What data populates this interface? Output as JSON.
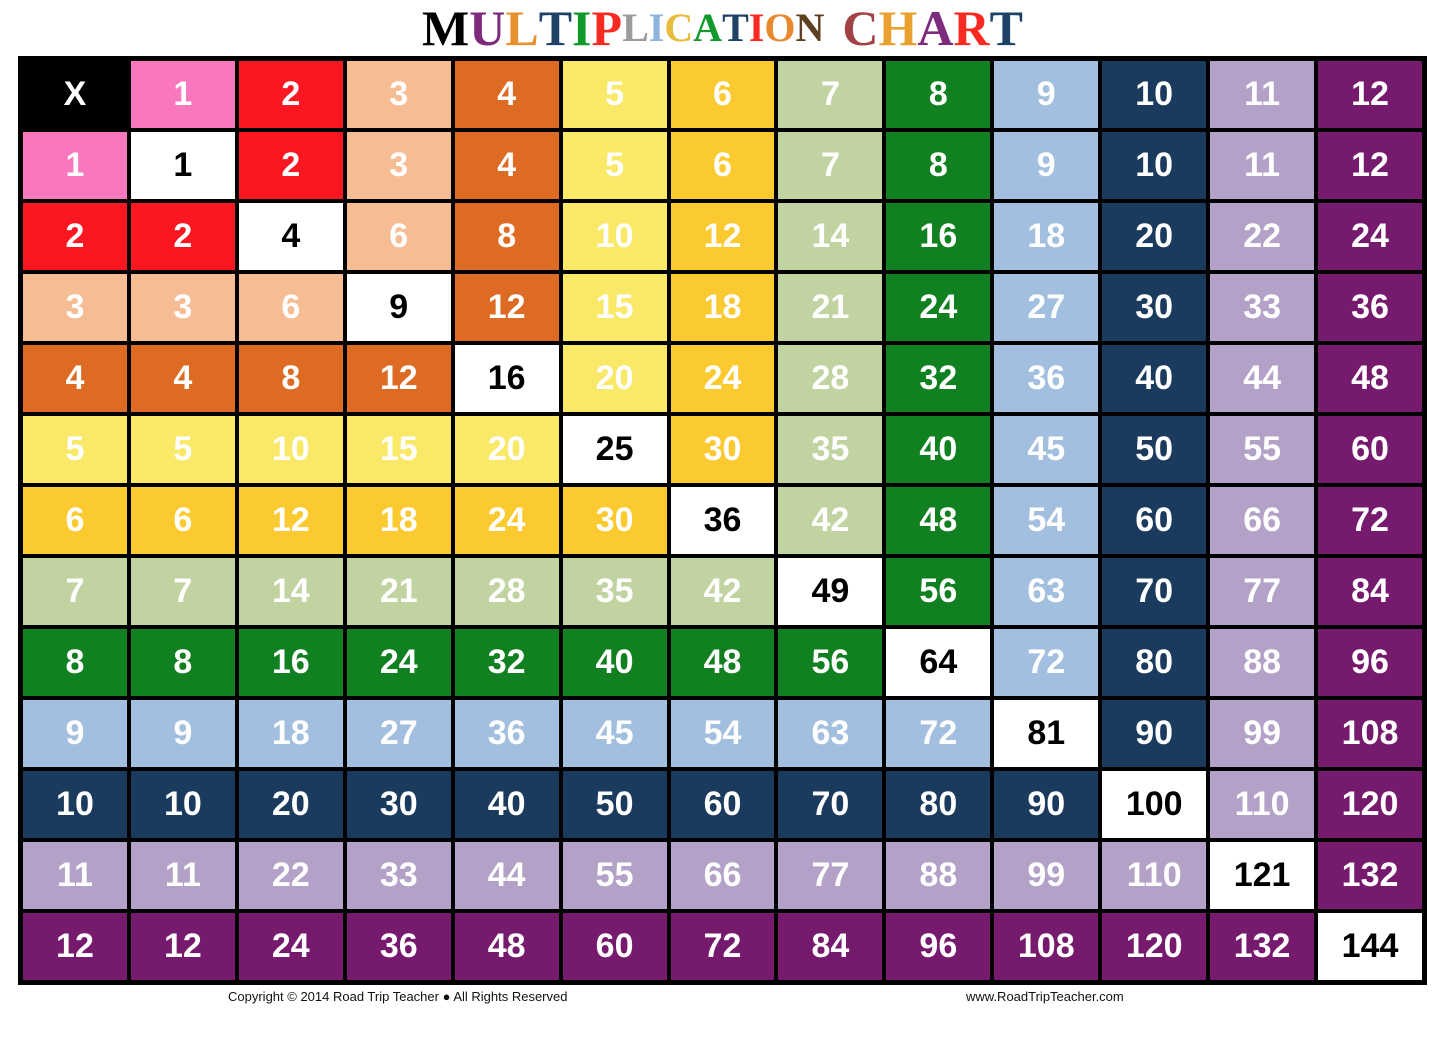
{
  "title": {
    "text": "MULTIPLICATION CHART",
    "letters": [
      {
        "ch": "M",
        "color": "#000000",
        "cap": true
      },
      {
        "ch": "U",
        "color": "#7d2b7d",
        "cap": true
      },
      {
        "ch": "L",
        "color": "#e8922f",
        "cap": true
      },
      {
        "ch": "T",
        "color": "#1d4266",
        "cap": true
      },
      {
        "ch": "I",
        "color": "#0f9a2b",
        "cap": true
      },
      {
        "ch": "P",
        "color": "#f92a22",
        "cap": true
      },
      {
        "ch": "L",
        "color": "#9b9b9b",
        "cap": false
      },
      {
        "ch": "I",
        "color": "#8cb4de",
        "cap": false
      },
      {
        "ch": "C",
        "color": "#e8bb3c",
        "cap": false
      },
      {
        "ch": "A",
        "color": "#0f9a2b",
        "cap": false
      },
      {
        "ch": "T",
        "color": "#1d4266",
        "cap": false
      },
      {
        "ch": "I",
        "color": "#f92a22",
        "cap": false
      },
      {
        "ch": "O",
        "color": "#e8892f",
        "cap": false
      },
      {
        "ch": "N",
        "color": "#5e4020",
        "cap": false
      },
      {
        "ch": " ",
        "color": "#000000",
        "cap": false
      },
      {
        "ch": "C",
        "color": "#a34244",
        "cap": true
      },
      {
        "ch": "H",
        "color": "#e8a02f",
        "cap": true
      },
      {
        "ch": "A",
        "color": "#7d2b7d",
        "cap": true
      },
      {
        "ch": "R",
        "color": "#f92a22",
        "cap": true
      },
      {
        "ch": "T",
        "color": "#1d4266",
        "cap": true
      }
    ]
  },
  "table": {
    "corner_label": "X",
    "headers": [
      "1",
      "2",
      "3",
      "4",
      "5",
      "6",
      "7",
      "8",
      "9",
      "10",
      "11",
      "12"
    ],
    "row_headers": [
      "1",
      "2",
      "3",
      "4",
      "5",
      "6",
      "7",
      "8",
      "9",
      "10",
      "11",
      "12"
    ],
    "colors": [
      "#f978bd",
      "#fa1721",
      "#f6bd95",
      "#dd6b24",
      "#fae968",
      "#fbc930",
      "#c1d3a0",
      "#118020",
      "#a3bfdf",
      "#1b3b5e",
      "#b3a1c7",
      "#761a6e"
    ],
    "diagonal_bg": "#ffffff",
    "diagonal_fg": "#000000",
    "cell_text_color": "#ffffff",
    "grid_color": "#000000",
    "rows": [
      [
        "1",
        "2",
        "3",
        "4",
        "5",
        "6",
        "7",
        "8",
        "9",
        "10",
        "11",
        "12"
      ],
      [
        "2",
        "4",
        "6",
        "8",
        "10",
        "12",
        "14",
        "16",
        "18",
        "20",
        "22",
        "24"
      ],
      [
        "3",
        "6",
        "9",
        "12",
        "15",
        "18",
        "21",
        "24",
        "27",
        "30",
        "33",
        "36"
      ],
      [
        "4",
        "8",
        "12",
        "16",
        "20",
        "24",
        "28",
        "32",
        "36",
        "40",
        "44",
        "48"
      ],
      [
        "5",
        "10",
        "15",
        "20",
        "25",
        "30",
        "35",
        "40",
        "45",
        "50",
        "55",
        "60"
      ],
      [
        "6",
        "12",
        "18",
        "24",
        "30",
        "36",
        "42",
        "48",
        "54",
        "60",
        "66",
        "72"
      ],
      [
        "7",
        "14",
        "21",
        "28",
        "35",
        "42",
        "49",
        "56",
        "63",
        "70",
        "77",
        "84"
      ],
      [
        "8",
        "16",
        "24",
        "32",
        "40",
        "48",
        "56",
        "64",
        "72",
        "80",
        "88",
        "96"
      ],
      [
        "9",
        "18",
        "27",
        "36",
        "45",
        "54",
        "63",
        "72",
        "81",
        "90",
        "99",
        "108"
      ],
      [
        "10",
        "20",
        "30",
        "40",
        "50",
        "60",
        "70",
        "80",
        "90",
        "100",
        "110",
        "120"
      ],
      [
        "11",
        "22",
        "33",
        "44",
        "55",
        "66",
        "77",
        "88",
        "99",
        "110",
        "121",
        "132"
      ],
      [
        "12",
        "24",
        "36",
        "48",
        "60",
        "72",
        "84",
        "96",
        "108",
        "120",
        "132",
        "144"
      ]
    ]
  },
  "footer": {
    "copyright": "Copyright © 2014 Road Trip Teacher ● All Rights Reserved",
    "website": "www.RoadTripTeacher.com"
  }
}
